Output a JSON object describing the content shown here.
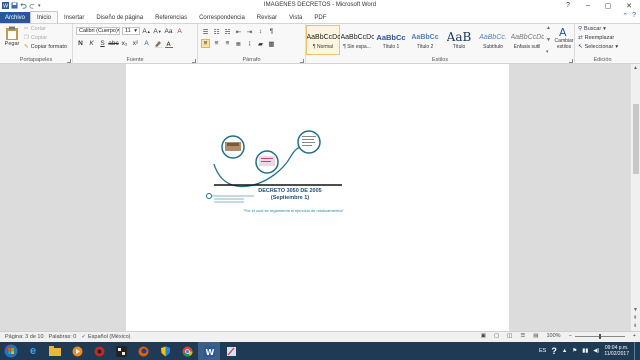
{
  "window": {
    "title": "IMAGENES DECRETOS - Microsoft Word"
  },
  "tabs": [
    {
      "label": "Archivo"
    },
    {
      "label": "Inicio"
    },
    {
      "label": "Insertar"
    },
    {
      "label": "Diseño de página"
    },
    {
      "label": "Referencias"
    },
    {
      "label": "Correspondencia"
    },
    {
      "label": "Revisar"
    },
    {
      "label": "Vista"
    },
    {
      "label": "PDF"
    }
  ],
  "clipboard": {
    "label": "Portapapeles",
    "paste": "Pegar",
    "cut": "Cortar",
    "copy": "Copiar",
    "format_painter": "Copiar formato"
  },
  "font": {
    "label": "Fuente",
    "family": "Calibri (Cuerpo)",
    "size": "11"
  },
  "paragraph": {
    "label": "Párrafo"
  },
  "styles": {
    "label": "Estilos",
    "items": [
      {
        "sample": "AaBbCcDc",
        "name": "¶ Normal"
      },
      {
        "sample": "AaBbCcDc",
        "name": "¶ Sin espa..."
      },
      {
        "sample": "AaBbCc",
        "name": "Título 1"
      },
      {
        "sample": "AaBbCc",
        "name": "Título 2"
      },
      {
        "sample": "AaB",
        "name": "Título"
      },
      {
        "sample": "AaBbCc.",
        "name": "Subtítulo"
      },
      {
        "sample": "AaBbCcDc",
        "name": "Énfasis sutil"
      }
    ],
    "change": "Cambiar estilos"
  },
  "editing": {
    "label": "Edición",
    "find": "Buscar",
    "replace": "Reemplazar",
    "select": "Seleccionar"
  },
  "document": {
    "heading": "DECRETO 3050 DE 2005",
    "subheading": "(Septiembre 1)",
    "caption": "\"Por el cual se reglamenta el ejercicio de medicamentos\""
  },
  "status": {
    "page": "Página: 3 de 10",
    "words": "Palabras: 0",
    "language": "Español (México)",
    "zoom": "100%"
  },
  "taskbar": {
    "lang": "ES",
    "time": "09:04 p.m.",
    "date": "11/02/2017"
  },
  "colors": {
    "file_tab": "#2b579a",
    "taskbar": "#1f3a55",
    "prezi_teal": "#1f6f8b"
  }
}
